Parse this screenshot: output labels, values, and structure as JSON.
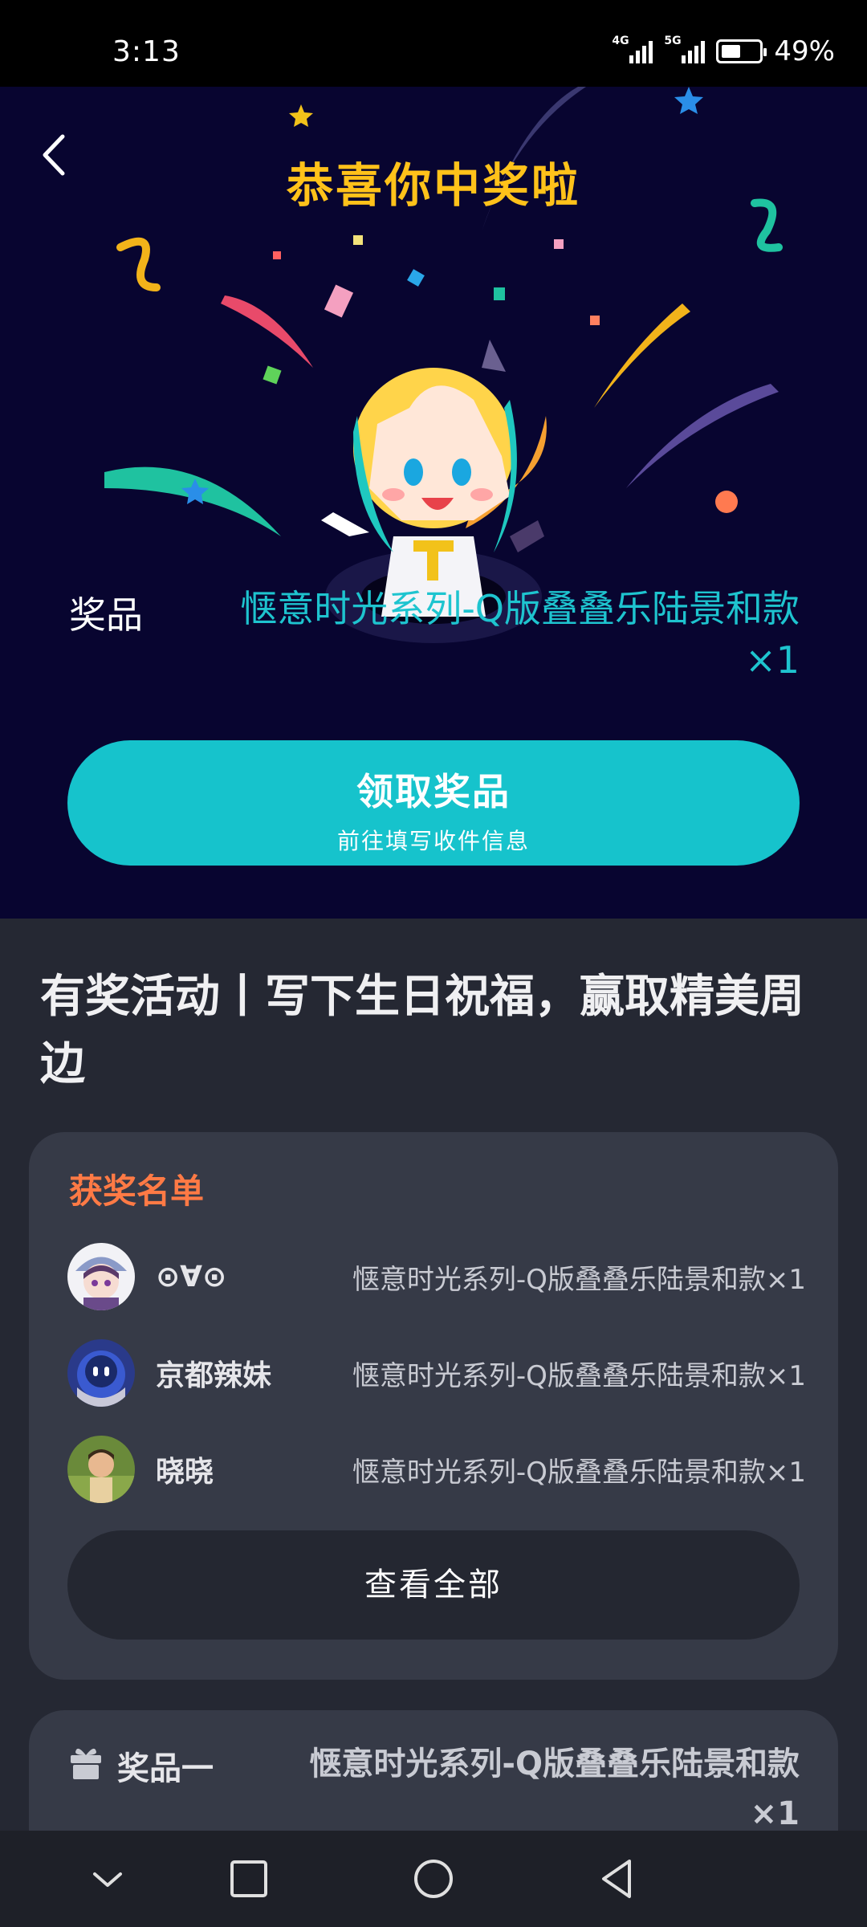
{
  "status_bar": {
    "time": "3:13",
    "net1": "4G",
    "net2": "5G",
    "battery_percent": "49%",
    "battery_level": 0.49
  },
  "hero": {
    "title": "恭喜你中奖啦",
    "prize_label": "奖品",
    "prize_name": "惬意时光系列-Q版叠叠乐陆景和款",
    "prize_qty": "×1",
    "claim_button": {
      "label": "领取奖品",
      "sublabel": "前往填写收件信息"
    }
  },
  "activity": {
    "title": "有奖活动丨写下生日祝福，赢取精美周边"
  },
  "winners": {
    "title": "获奖名单",
    "items": [
      {
        "name": "⊙∀⊙",
        "prize": "惬意时光系列-Q版叠叠乐陆景和款×1"
      },
      {
        "name": "京都辣妹",
        "prize": "惬意时光系列-Q版叠叠乐陆景和款×1"
      },
      {
        "name": "晓晓",
        "prize": "惬意时光系列-Q版叠叠乐陆景和款×1"
      }
    ],
    "view_all": "查看全部"
  },
  "prize_list": {
    "item_label": "奖品一",
    "item_name": "惬意时光系列-Q版叠叠乐陆景和款×1"
  },
  "colors": {
    "hero_bg": "#080530",
    "title_gold": "#ffc21a",
    "accent_cyan": "#16c3cc",
    "winner_orange": "#ff7a45",
    "page_bg": "#252833",
    "card_bg": "#363a47"
  },
  "icons": {
    "back": "chevron-left-icon",
    "gift": "gift-icon",
    "nav": [
      "chevron-down-icon",
      "square-icon",
      "circle-icon",
      "triangle-back-icon"
    ]
  }
}
